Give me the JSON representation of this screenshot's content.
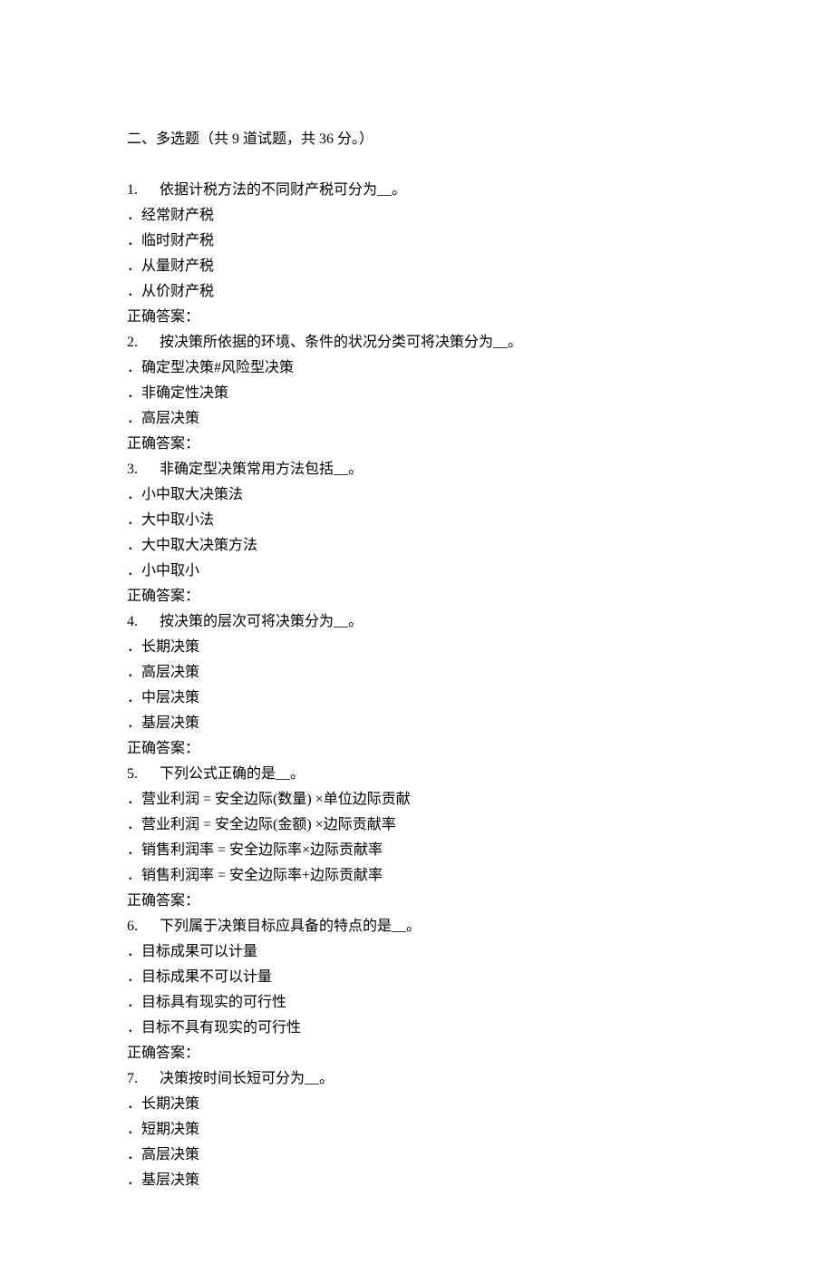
{
  "section": {
    "title": "二、多选题（共 9 道试题，共 36 分。）"
  },
  "questions": [
    {
      "num": "1.",
      "stem": "依据计税方法的不同财产税可分为__。",
      "options": [
        "．经常财产税",
        "．临时财产税",
        "．从量财产税",
        "．从价财产税"
      ],
      "answer_label": "正确答案："
    },
    {
      "num": "2.",
      "stem": "按决策所依据的环境、条件的状况分类可将决策分为__。",
      "options": [
        "．确定型决策#风险型决策",
        "．非确定性决策",
        "．高层决策"
      ],
      "answer_label": "正确答案："
    },
    {
      "num": "3.",
      "stem": "非确定型决策常用方法包括__。",
      "options": [
        "．小中取大决策法",
        "．大中取小法",
        "．大中取大决策方法",
        "．小中取小"
      ],
      "answer_label": "正确答案："
    },
    {
      "num": "4.",
      "stem": "按决策的层次可将决策分为__。",
      "options": [
        "．长期决策",
        "．高层决策",
        "．中层决策",
        "．基层决策"
      ],
      "answer_label": "正确答案："
    },
    {
      "num": "5.",
      "stem": "下列公式正确的是__。",
      "options": [
        "．营业利润 = 安全边际(数量) ×单位边际贡献",
        "．营业利润 = 安全边际(金额) ×边际贡献率",
        "．销售利润率 = 安全边际率×边际贡献率",
        "．销售利润率 = 安全边际率+边际贡献率"
      ],
      "answer_label": "正确答案："
    },
    {
      "num": "6.",
      "stem": "下列属于决策目标应具备的特点的是__。",
      "options": [
        "．目标成果可以计量",
        "．目标成果不可以计量",
        "．目标具有现实的可行性",
        "．目标不具有现实的可行性"
      ],
      "answer_label": "正确答案："
    },
    {
      "num": "7.",
      "stem": "决策按时间长短可分为__。",
      "options": [
        "．长期决策",
        "．短期决策",
        "．高层决策",
        "．基层决策"
      ],
      "answer_label": ""
    }
  ]
}
